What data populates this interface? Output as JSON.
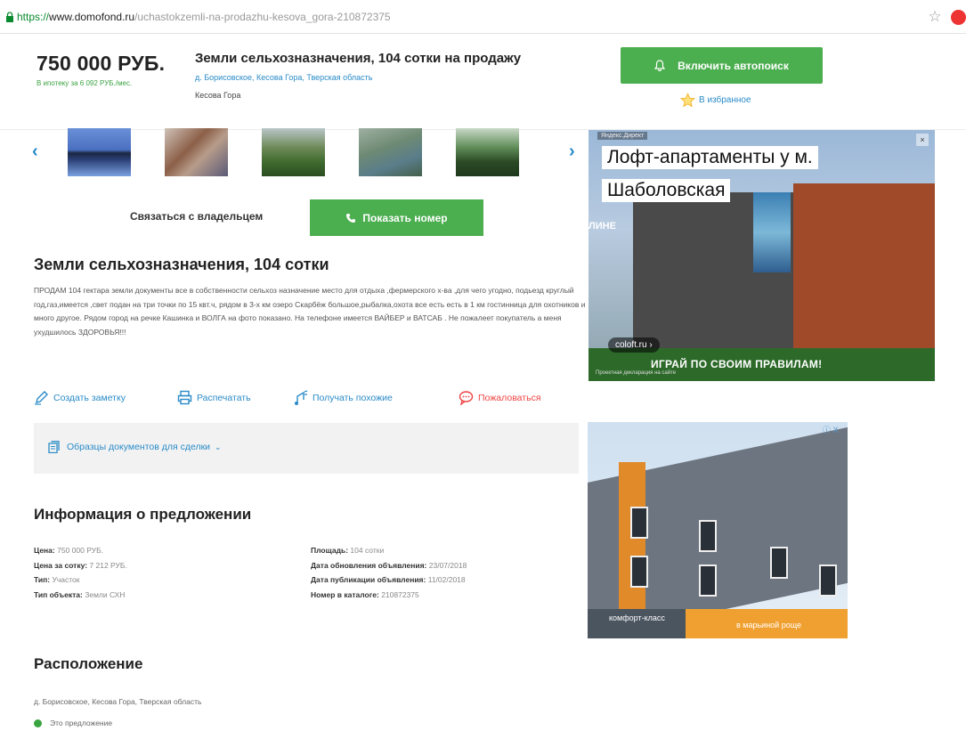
{
  "browser": {
    "url_scheme": "https://",
    "url_host": "www.domofond.ru",
    "url_path": "/uchastokzemli-na-prodazhu-kesova_gora-210872375"
  },
  "header": {
    "price": "750 000 РУБ.",
    "price_per": "В ипотеку за 6 092 РУБ./мес.",
    "title": "Земли сельхозназначения, 104 сотки на продажу",
    "address": "д. Борисовское, Кесова Гора, Тверская область",
    "place": "Кесова Гора",
    "autosearch_label": "Включить автопоиск",
    "favorites_label": "В избранное"
  },
  "gallery": {
    "prev": "‹",
    "next": "›"
  },
  "contact": {
    "label": "Связаться с владельцем",
    "phone_button": "Показать номер"
  },
  "listing": {
    "title": "Земли сельхозназначения, 104 сотки",
    "description": "ПРОДАМ 104 гектара земли документы все в собственности сельхоз назначение место для отдыха ,фермерского х-ва ,для чего угодно, подьезд круглый год,газ,имеется ,свет подан на три точки по 15 квт.ч, рядом в 3-х км озеро Скарбёж большое,рыбалка,охота все есть есть в 1 км гостинница для охотников и много другое. Рядом город на речке Кашинка и ВОЛГА на фото показано. На телефоне имеется ВАЙБЕР и ВАТСАБ . Не пожалеет покупатель а меня ухудшилось ЗДОРОВЬЯ!!!"
  },
  "actions": {
    "note": "Создать заметку",
    "print": "Распечатать",
    "similar": "Получать похожие",
    "complain": "Пожаловаться"
  },
  "docs": {
    "label": "Образцы документов для сделки"
  },
  "info": {
    "title": "Информация о предложении",
    "left": [
      {
        "key": "Цена:",
        "value": "750 000 РУБ."
      },
      {
        "key": "Цена за сотку:",
        "value": "7 212 РУБ."
      },
      {
        "key": "Тип:",
        "value": "Участок"
      },
      {
        "key": "Тип объекта:",
        "value": "Земли СХН"
      }
    ],
    "right": [
      {
        "key": "Площадь:",
        "value": "104 сотки"
      },
      {
        "key": "Дата обновления объявления:",
        "value": "23/07/2018"
      },
      {
        "key": "Дата публикации объявления:",
        "value": "11/02/2018"
      },
      {
        "key": "Номер в каталоге:",
        "value": "210872375"
      }
    ]
  },
  "location": {
    "title": "Расположение",
    "address": "д. Борисовское, Кесова Гора, Тверская область",
    "legend": "Это предложение"
  },
  "ads": {
    "ad1": {
      "badge": "Яндекс.Директ",
      "close": "×",
      "line1": "Лофт-апартаменты у м.",
      "line2": "Шаболовская",
      "side": "ЛИНЕ",
      "pill": "coloft.ru ›",
      "slogan": "ИГРАЙ ПО СВОИМ ПРАВИЛАМ!",
      "disclaimer": "Проектная декларация на сайте"
    },
    "ad2": {
      "close": "ⓘ X",
      "text1": "комфорт-класс",
      "text2": "в марьиной роще"
    }
  },
  "colors": {
    "accent_green": "#4bae4f",
    "link_blue": "#2a8bc8",
    "complain_red": "#e44444"
  }
}
